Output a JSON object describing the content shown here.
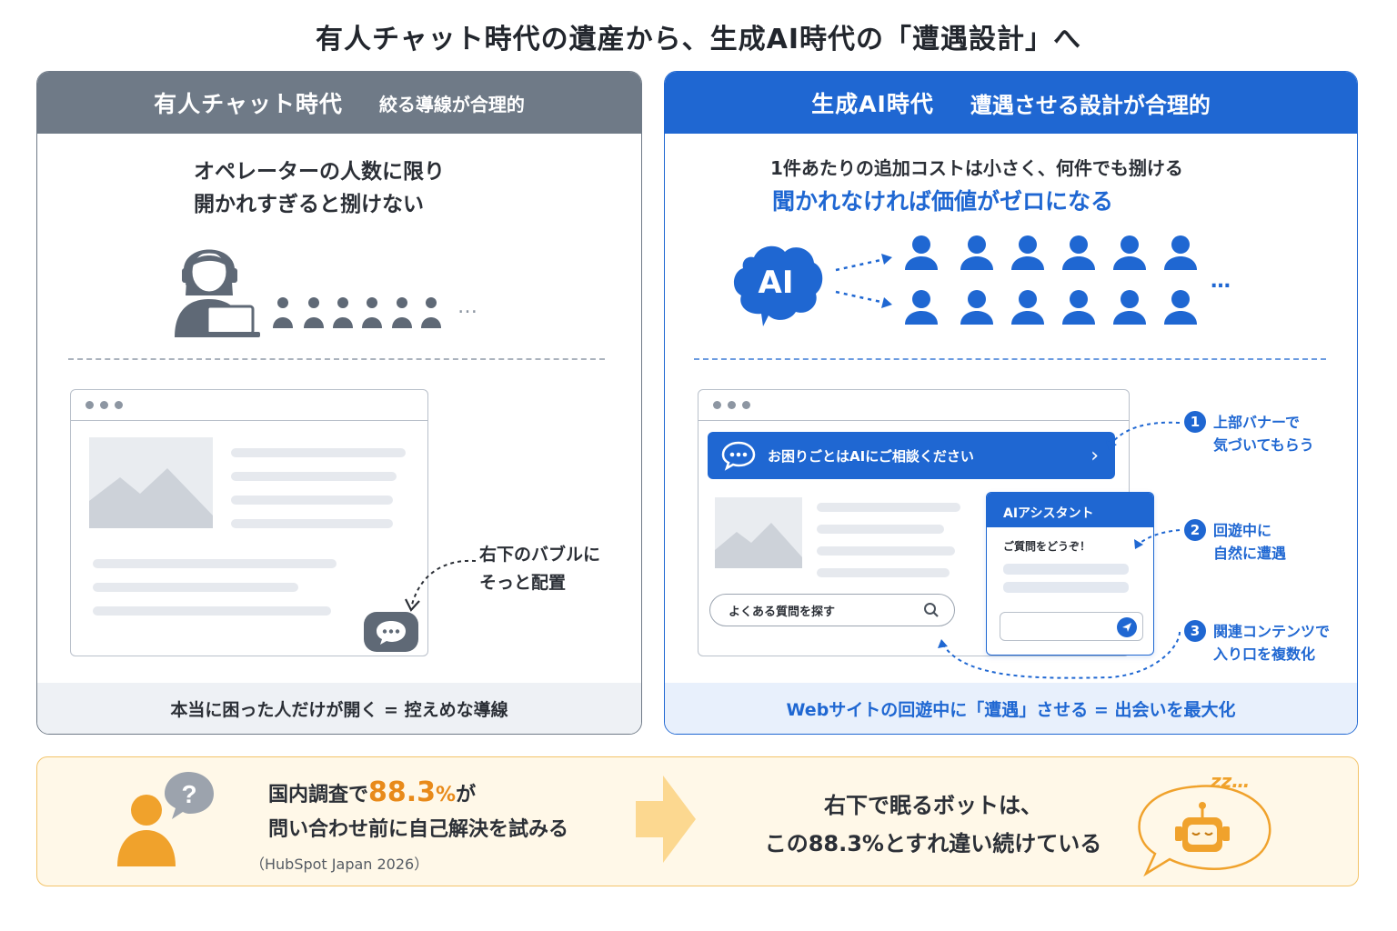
{
  "title": "有人チャット時代の遺産から、生成AI時代の「遭遇設計」へ",
  "left_panel": {
    "header_main": "有人チャット時代",
    "header_sub": "絞る導線が合理的",
    "lead_line1": "オペレーターの人数に限り",
    "lead_line2": "開かれすぎると捌けない",
    "more": "…",
    "annotation_line1": "右下のバブルに",
    "annotation_line2": "そっと配置",
    "footer": "本当に困った人だけが開く = 控えめな導線"
  },
  "right_panel": {
    "header_main": "生成AI時代",
    "header_sub": "遭遇させる設計が合理的",
    "lead_line1": "1件あたりの追加コストは小さく、何件でも捌ける",
    "lead_line2": "聞かれなければ価値がゼロになる",
    "ai_label": "AI",
    "more": "…",
    "banner_text": "お困りごとはAIにご相談ください",
    "search_placeholder": "よくある質問を探す",
    "assistant_title": "AIアシスタント",
    "assistant_greeting": "ご質問をどうぞ！",
    "points": [
      {
        "num": "1",
        "line1": "上部バナーで",
        "line2": "気づいてもらう"
      },
      {
        "num": "2",
        "line1": "回遊中に",
        "line2": "自然に遭遇"
      },
      {
        "num": "3",
        "line1": "関連コンテンツで",
        "line2": "入り口を複数化"
      }
    ],
    "footer": "Webサイトの回遊中に「遭遇」させる = 出会いを最大化"
  },
  "bottom": {
    "left_pre": "国内調査で",
    "left_stat": "88.3",
    "left_unit": "%",
    "left_post": "が",
    "left_line2": "問い合わせ前に自己解決を試みる",
    "source": "（HubSpot Japan 2026）",
    "right_line1": "右下で眠るボットは、",
    "right_line2": "この88.3%とすれ違い続けている",
    "zzz": "zz…"
  },
  "colors": {
    "gray_header": "#6f7a87",
    "blue_accent": "#1f67d2",
    "orange_accent": "#e88a1a",
    "bottom_bg": "#fff8e8"
  }
}
